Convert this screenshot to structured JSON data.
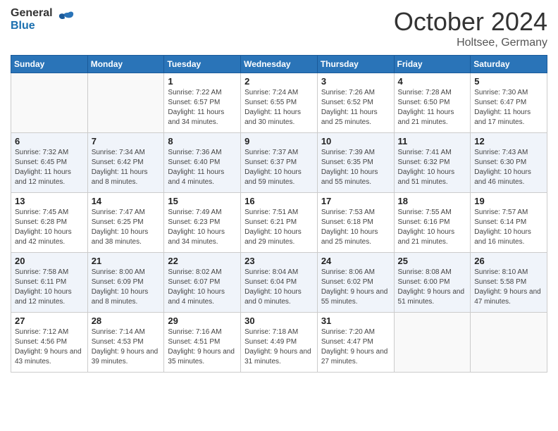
{
  "logo": {
    "general": "General",
    "blue": "Blue"
  },
  "title": "October 2024",
  "location": "Holtsee, Germany",
  "days_of_week": [
    "Sunday",
    "Monday",
    "Tuesday",
    "Wednesday",
    "Thursday",
    "Friday",
    "Saturday"
  ],
  "weeks": [
    [
      {
        "day": "",
        "sunrise": "",
        "sunset": "",
        "daylight": ""
      },
      {
        "day": "",
        "sunrise": "",
        "sunset": "",
        "daylight": ""
      },
      {
        "day": "1",
        "sunrise": "Sunrise: 7:22 AM",
        "sunset": "Sunset: 6:57 PM",
        "daylight": "Daylight: 11 hours and 34 minutes."
      },
      {
        "day": "2",
        "sunrise": "Sunrise: 7:24 AM",
        "sunset": "Sunset: 6:55 PM",
        "daylight": "Daylight: 11 hours and 30 minutes."
      },
      {
        "day": "3",
        "sunrise": "Sunrise: 7:26 AM",
        "sunset": "Sunset: 6:52 PM",
        "daylight": "Daylight: 11 hours and 25 minutes."
      },
      {
        "day": "4",
        "sunrise": "Sunrise: 7:28 AM",
        "sunset": "Sunset: 6:50 PM",
        "daylight": "Daylight: 11 hours and 21 minutes."
      },
      {
        "day": "5",
        "sunrise": "Sunrise: 7:30 AM",
        "sunset": "Sunset: 6:47 PM",
        "daylight": "Daylight: 11 hours and 17 minutes."
      }
    ],
    [
      {
        "day": "6",
        "sunrise": "Sunrise: 7:32 AM",
        "sunset": "Sunset: 6:45 PM",
        "daylight": "Daylight: 11 hours and 12 minutes."
      },
      {
        "day": "7",
        "sunrise": "Sunrise: 7:34 AM",
        "sunset": "Sunset: 6:42 PM",
        "daylight": "Daylight: 11 hours and 8 minutes."
      },
      {
        "day": "8",
        "sunrise": "Sunrise: 7:36 AM",
        "sunset": "Sunset: 6:40 PM",
        "daylight": "Daylight: 11 hours and 4 minutes."
      },
      {
        "day": "9",
        "sunrise": "Sunrise: 7:37 AM",
        "sunset": "Sunset: 6:37 PM",
        "daylight": "Daylight: 10 hours and 59 minutes."
      },
      {
        "day": "10",
        "sunrise": "Sunrise: 7:39 AM",
        "sunset": "Sunset: 6:35 PM",
        "daylight": "Daylight: 10 hours and 55 minutes."
      },
      {
        "day": "11",
        "sunrise": "Sunrise: 7:41 AM",
        "sunset": "Sunset: 6:32 PM",
        "daylight": "Daylight: 10 hours and 51 minutes."
      },
      {
        "day": "12",
        "sunrise": "Sunrise: 7:43 AM",
        "sunset": "Sunset: 6:30 PM",
        "daylight": "Daylight: 10 hours and 46 minutes."
      }
    ],
    [
      {
        "day": "13",
        "sunrise": "Sunrise: 7:45 AM",
        "sunset": "Sunset: 6:28 PM",
        "daylight": "Daylight: 10 hours and 42 minutes."
      },
      {
        "day": "14",
        "sunrise": "Sunrise: 7:47 AM",
        "sunset": "Sunset: 6:25 PM",
        "daylight": "Daylight: 10 hours and 38 minutes."
      },
      {
        "day": "15",
        "sunrise": "Sunrise: 7:49 AM",
        "sunset": "Sunset: 6:23 PM",
        "daylight": "Daylight: 10 hours and 34 minutes."
      },
      {
        "day": "16",
        "sunrise": "Sunrise: 7:51 AM",
        "sunset": "Sunset: 6:21 PM",
        "daylight": "Daylight: 10 hours and 29 minutes."
      },
      {
        "day": "17",
        "sunrise": "Sunrise: 7:53 AM",
        "sunset": "Sunset: 6:18 PM",
        "daylight": "Daylight: 10 hours and 25 minutes."
      },
      {
        "day": "18",
        "sunrise": "Sunrise: 7:55 AM",
        "sunset": "Sunset: 6:16 PM",
        "daylight": "Daylight: 10 hours and 21 minutes."
      },
      {
        "day": "19",
        "sunrise": "Sunrise: 7:57 AM",
        "sunset": "Sunset: 6:14 PM",
        "daylight": "Daylight: 10 hours and 16 minutes."
      }
    ],
    [
      {
        "day": "20",
        "sunrise": "Sunrise: 7:58 AM",
        "sunset": "Sunset: 6:11 PM",
        "daylight": "Daylight: 10 hours and 12 minutes."
      },
      {
        "day": "21",
        "sunrise": "Sunrise: 8:00 AM",
        "sunset": "Sunset: 6:09 PM",
        "daylight": "Daylight: 10 hours and 8 minutes."
      },
      {
        "day": "22",
        "sunrise": "Sunrise: 8:02 AM",
        "sunset": "Sunset: 6:07 PM",
        "daylight": "Daylight: 10 hours and 4 minutes."
      },
      {
        "day": "23",
        "sunrise": "Sunrise: 8:04 AM",
        "sunset": "Sunset: 6:04 PM",
        "daylight": "Daylight: 10 hours and 0 minutes."
      },
      {
        "day": "24",
        "sunrise": "Sunrise: 8:06 AM",
        "sunset": "Sunset: 6:02 PM",
        "daylight": "Daylight: 9 hours and 55 minutes."
      },
      {
        "day": "25",
        "sunrise": "Sunrise: 8:08 AM",
        "sunset": "Sunset: 6:00 PM",
        "daylight": "Daylight: 9 hours and 51 minutes."
      },
      {
        "day": "26",
        "sunrise": "Sunrise: 8:10 AM",
        "sunset": "Sunset: 5:58 PM",
        "daylight": "Daylight: 9 hours and 47 minutes."
      }
    ],
    [
      {
        "day": "27",
        "sunrise": "Sunrise: 7:12 AM",
        "sunset": "Sunset: 4:56 PM",
        "daylight": "Daylight: 9 hours and 43 minutes."
      },
      {
        "day": "28",
        "sunrise": "Sunrise: 7:14 AM",
        "sunset": "Sunset: 4:53 PM",
        "daylight": "Daylight: 9 hours and 39 minutes."
      },
      {
        "day": "29",
        "sunrise": "Sunrise: 7:16 AM",
        "sunset": "Sunset: 4:51 PM",
        "daylight": "Daylight: 9 hours and 35 minutes."
      },
      {
        "day": "30",
        "sunrise": "Sunrise: 7:18 AM",
        "sunset": "Sunset: 4:49 PM",
        "daylight": "Daylight: 9 hours and 31 minutes."
      },
      {
        "day": "31",
        "sunrise": "Sunrise: 7:20 AM",
        "sunset": "Sunset: 4:47 PM",
        "daylight": "Daylight: 9 hours and 27 minutes."
      },
      {
        "day": "",
        "sunrise": "",
        "sunset": "",
        "daylight": ""
      },
      {
        "day": "",
        "sunrise": "",
        "sunset": "",
        "daylight": ""
      }
    ]
  ]
}
